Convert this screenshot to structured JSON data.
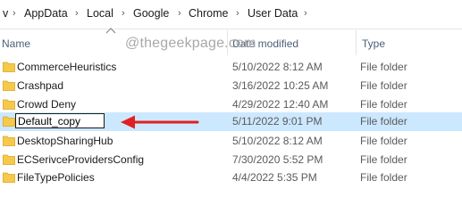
{
  "breadcrumb": {
    "partial_first": "v",
    "items": [
      "AppData",
      "Local",
      "Google",
      "Chrome",
      "User Data"
    ]
  },
  "columns": {
    "name": "Name",
    "date": "Date modified",
    "type": "Type"
  },
  "watermark": "@thegeekpage.com",
  "rename_value": "Default_copy",
  "rows": [
    {
      "name": "CommerceHeuristics",
      "date": "5/10/2022 8:12 AM",
      "type": "File folder"
    },
    {
      "name": "Crashpad",
      "date": "3/16/2022 10:25 AM",
      "type": "File folder"
    },
    {
      "name": "Crowd Deny",
      "date": "4/29/2022 12:40 AM",
      "type": "File folder"
    },
    {
      "name": "Default_copy",
      "date": "5/11/2022 9:01 PM",
      "type": "File folder",
      "selected": true
    },
    {
      "name": "DesktopSharingHub",
      "date": "5/10/2022 8:12 AM",
      "type": "File folder"
    },
    {
      "name": "ECSerivceProvidersConfig",
      "date": "7/30/2020 5:52 PM",
      "type": "File folder"
    },
    {
      "name": "FileTypePolicies",
      "date": "4/4/2022 5:35 PM",
      "type": "File folder"
    }
  ],
  "icons": {
    "folder": "folder-icon",
    "sort": "sort-ascending-icon",
    "chevron": "chevron-right-icon",
    "annotation": "red-arrow-icon"
  },
  "colors": {
    "selection": "#cce8ff",
    "folder": "#f7c94a",
    "annotation_arrow": "#e02020"
  }
}
